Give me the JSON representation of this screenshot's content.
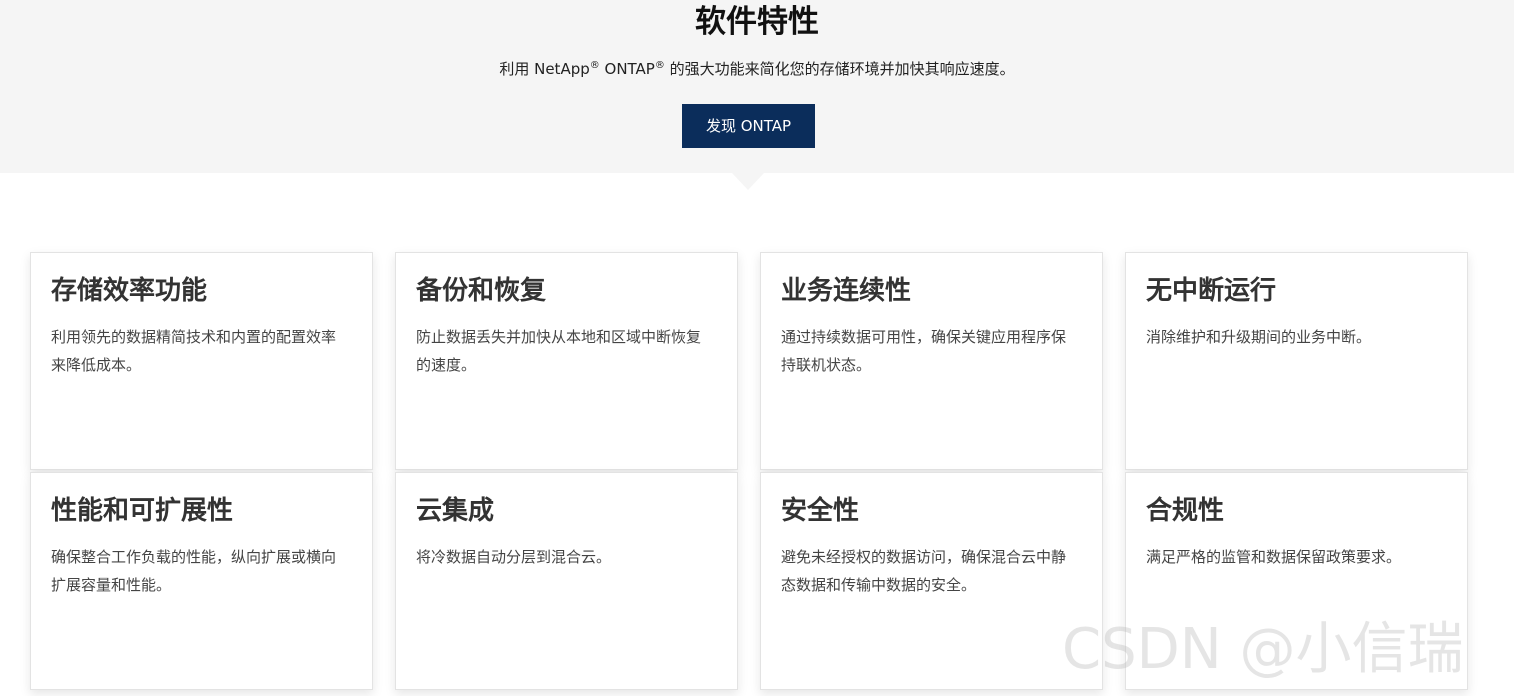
{
  "hero": {
    "title": "软件特性",
    "subtitle_pre": "利用 NetApp",
    "reg_mark": "®",
    "subtitle_mid": " ONTAP",
    "subtitle_post": " 的强大功能来简化您的存储环境并加快其响应速度。",
    "button_label": "发现 ONTAP",
    "background": "#f5f5f5",
    "button_color": "#0b2d5b"
  },
  "features": [
    {
      "title": "存储效率功能",
      "description": "利用领先的数据精简技术和内置的配置效率来降低成本。"
    },
    {
      "title": "备份和恢复",
      "description": "防止数据丢失并加快从本地和区域中断恢复的速度。"
    },
    {
      "title": "业务连续性",
      "description": "通过持续数据可用性，确保关键应用程序保持联机状态。"
    },
    {
      "title": "无中断运行",
      "description": "消除维护和升级期间的业务中断。"
    },
    {
      "title": "性能和可扩展性",
      "description": "确保整合工作负载的性能，纵向扩展或横向扩展容量和性能。"
    },
    {
      "title": "云集成",
      "description": "将冷数据自动分层到混合云。"
    },
    {
      "title": "安全性",
      "description": "避免未经授权的数据访问，确保混合云中静态数据和传输中数据的安全。"
    },
    {
      "title": "合规性",
      "description": "满足严格的监管和数据保留政策要求。"
    }
  ],
  "watermark": "CSDN @小信瑞"
}
